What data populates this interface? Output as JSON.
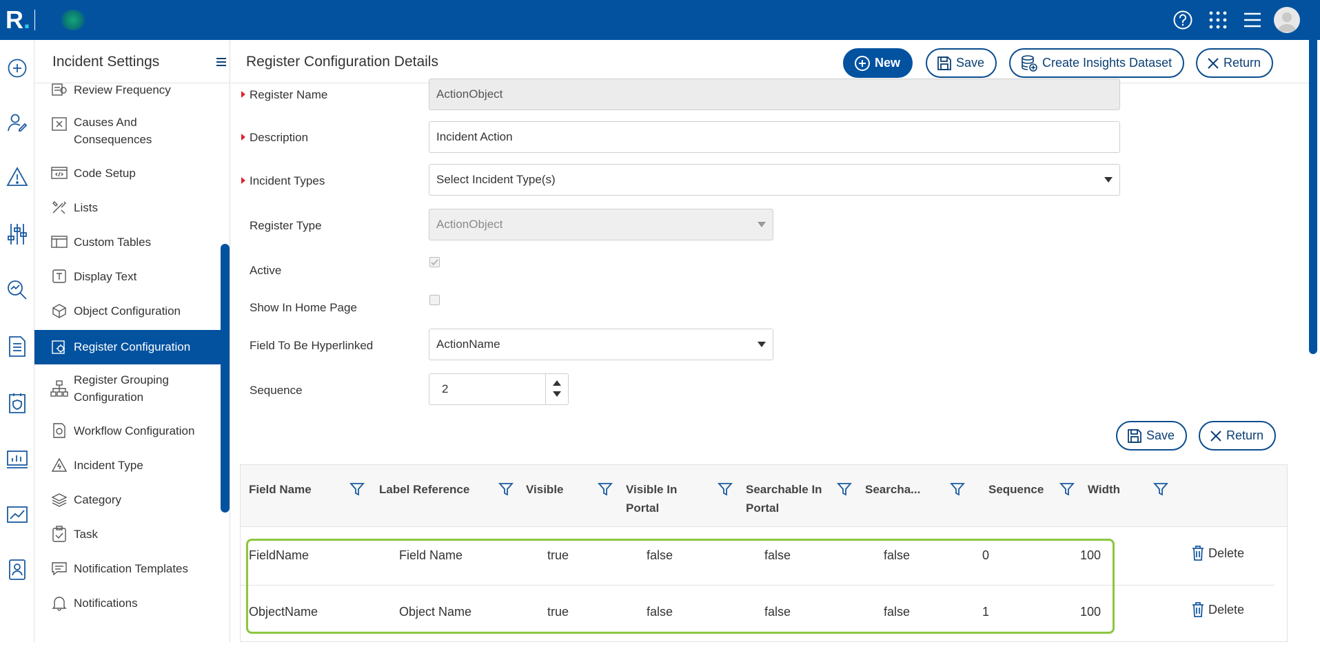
{
  "topbar": {
    "brand": "R",
    "brand_dot": "."
  },
  "sidebar": {
    "title": "Incident Settings",
    "items": [
      {
        "label": "Review Frequency",
        "icon": "review-frequency-icon"
      },
      {
        "label": "Causes And Consequences",
        "icon": "causes-icon"
      },
      {
        "label": "Code Setup",
        "icon": "code-setup-icon"
      },
      {
        "label": "Lists",
        "icon": "lists-tools-icon"
      },
      {
        "label": "Custom Tables",
        "icon": "custom-tables-icon"
      },
      {
        "label": "Display Text",
        "icon": "display-text-icon"
      },
      {
        "label": "Object Configuration",
        "icon": "object-configuration-icon"
      },
      {
        "label": "Register Configuration",
        "icon": "register-configuration-icon"
      },
      {
        "label": "Register Grouping Configuration",
        "icon": "register-grouping-icon"
      },
      {
        "label": "Workflow Configuration",
        "icon": "workflow-configuration-icon"
      },
      {
        "label": "Incident Type",
        "icon": "incident-type-icon"
      },
      {
        "label": "Category",
        "icon": "category-icon"
      },
      {
        "label": "Task",
        "icon": "task-icon"
      },
      {
        "label": "Notification Templates",
        "icon": "notification-templates-icon"
      },
      {
        "label": "Notifications",
        "icon": "bell-icon"
      }
    ]
  },
  "header": {
    "title": "Register Configuration Details",
    "new_label": "New",
    "save_label": "Save",
    "insights_label": "Create Insights Dataset",
    "return_label": "Return"
  },
  "form": {
    "register_name": {
      "label": "Register Name",
      "value": "ActionObject"
    },
    "description": {
      "label": "Description",
      "value": "Incident Action"
    },
    "incident_types": {
      "label": "Incident Types",
      "placeholder": "Select Incident Type(s)"
    },
    "register_type": {
      "label": "Register Type",
      "value": "ActionObject"
    },
    "active": {
      "label": "Active",
      "checked": true
    },
    "show_in_home": {
      "label": "Show In Home Page",
      "checked": false
    },
    "hyperlink_field": {
      "label": "Field To Be Hyperlinked",
      "value": "ActionName"
    },
    "sequence": {
      "label": "Sequence",
      "value": "2"
    },
    "save_label": "Save",
    "return_label": "Return"
  },
  "grid": {
    "headers": [
      "Field Name",
      "Label Reference",
      "Visible",
      "Visible In",
      "Portal",
      "Searchable In",
      "Portal",
      "Searcha...",
      "Sequence",
      "Width"
    ],
    "rows": [
      {
        "field_name": "FieldName",
        "label_reference": "Field Name",
        "visible": "true",
        "visible_in_portal": "false",
        "searchable_in_portal": "false",
        "searchable": "false",
        "sequence": "0",
        "width": "100",
        "action": "Delete"
      },
      {
        "field_name": "ObjectName",
        "label_reference": "Object Name",
        "visible": "true",
        "visible_in_portal": "false",
        "searchable_in_portal": "false",
        "searchable": "false",
        "sequence": "1",
        "width": "100",
        "action": "Delete"
      }
    ]
  },
  "colors": {
    "brand_blue": "#0252a0",
    "required_marker": "#d8272e",
    "highlight": "#8cc63f"
  }
}
